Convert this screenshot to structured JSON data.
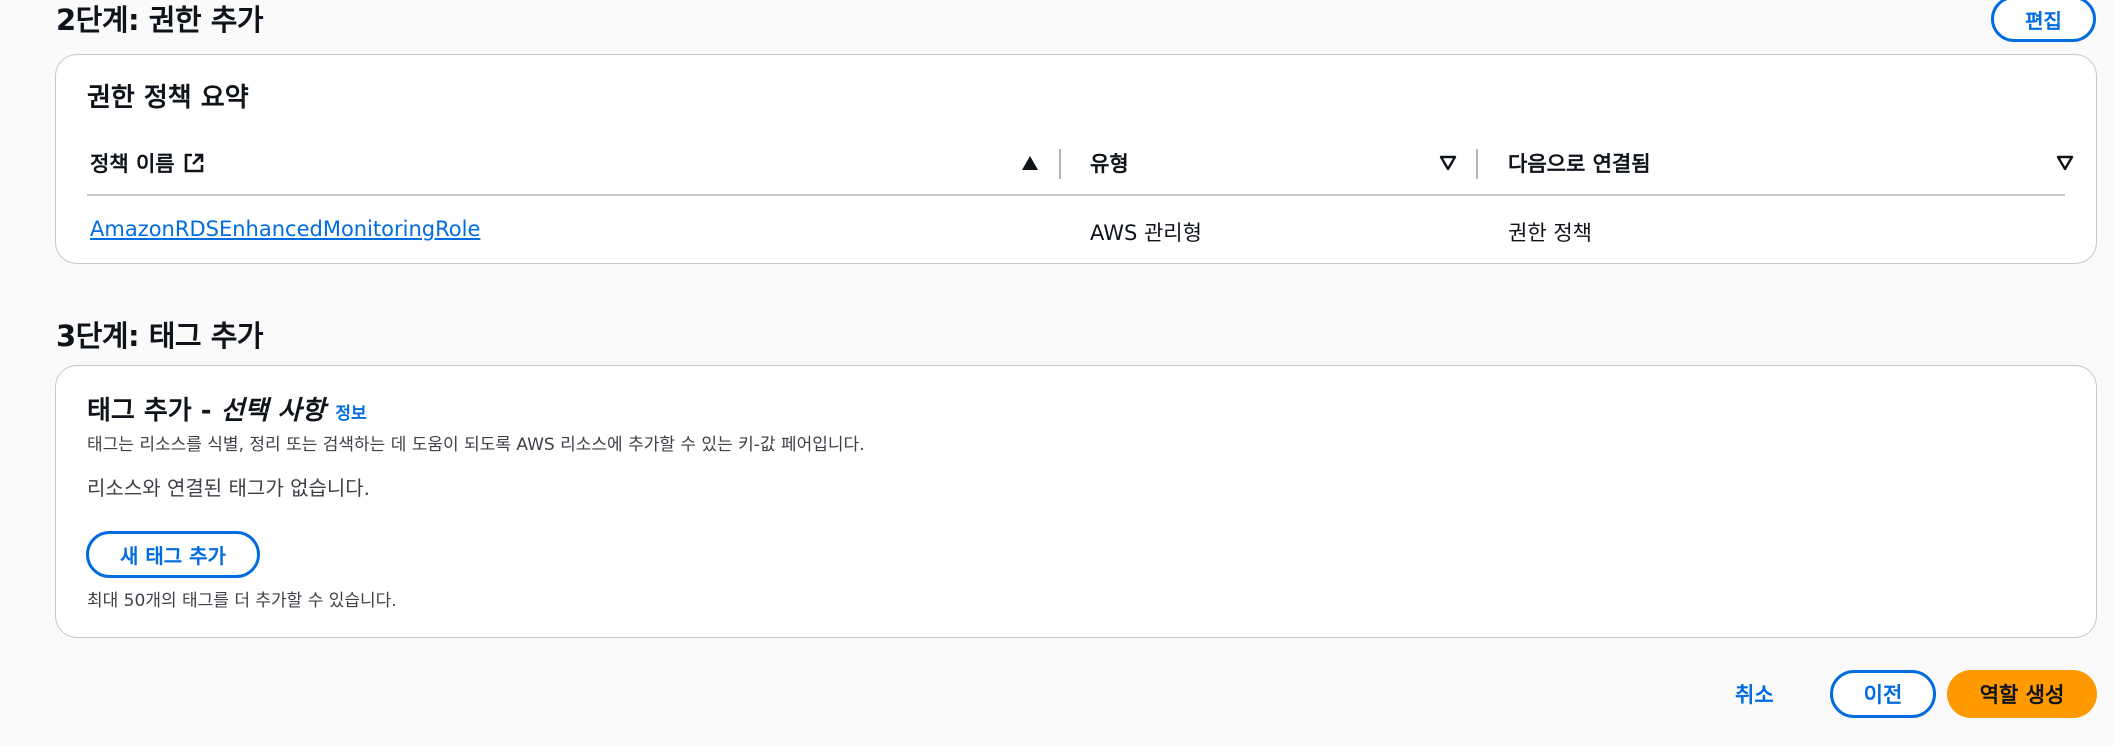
{
  "step2": {
    "title": "2단계: 권한 추가",
    "edit_label": "편집",
    "card_title": "권한 정책 요약",
    "columns": [
      "정책 이름",
      "유형",
      "다음으로 연결됨"
    ],
    "rows": [
      {
        "name": "AmazonRDSEnhancedMonitoringRole",
        "type": "AWS 관리형",
        "attached_as": "권한 정책"
      }
    ]
  },
  "step3": {
    "title": "3단계: 태그 추가",
    "card_title_main": "태그 추가 - ",
    "card_title_optional": "선택 사항",
    "info_label": "정보",
    "description": "태그는 리소스를 식별, 정리 또는 검색하는 데 도움이 되도록 AWS 리소스에 추가할 수 있는 키-값 페어입니다.",
    "empty_text": "리소스와 연결된 태그가 없습니다.",
    "add_tag_label": "새 태그 추가",
    "limit_text": "최대 50개의 태그를 더 추가할 수 있습니다."
  },
  "footer": {
    "cancel_label": "취소",
    "previous_label": "이전",
    "create_label": "역할 생성"
  },
  "colors": {
    "accent": "#006ce0",
    "primary_button": "#ff9900",
    "border": "#c6c6cd"
  },
  "icons": [
    "external-link-icon",
    "sort-ascending-icon",
    "sort-descending-icon"
  ]
}
